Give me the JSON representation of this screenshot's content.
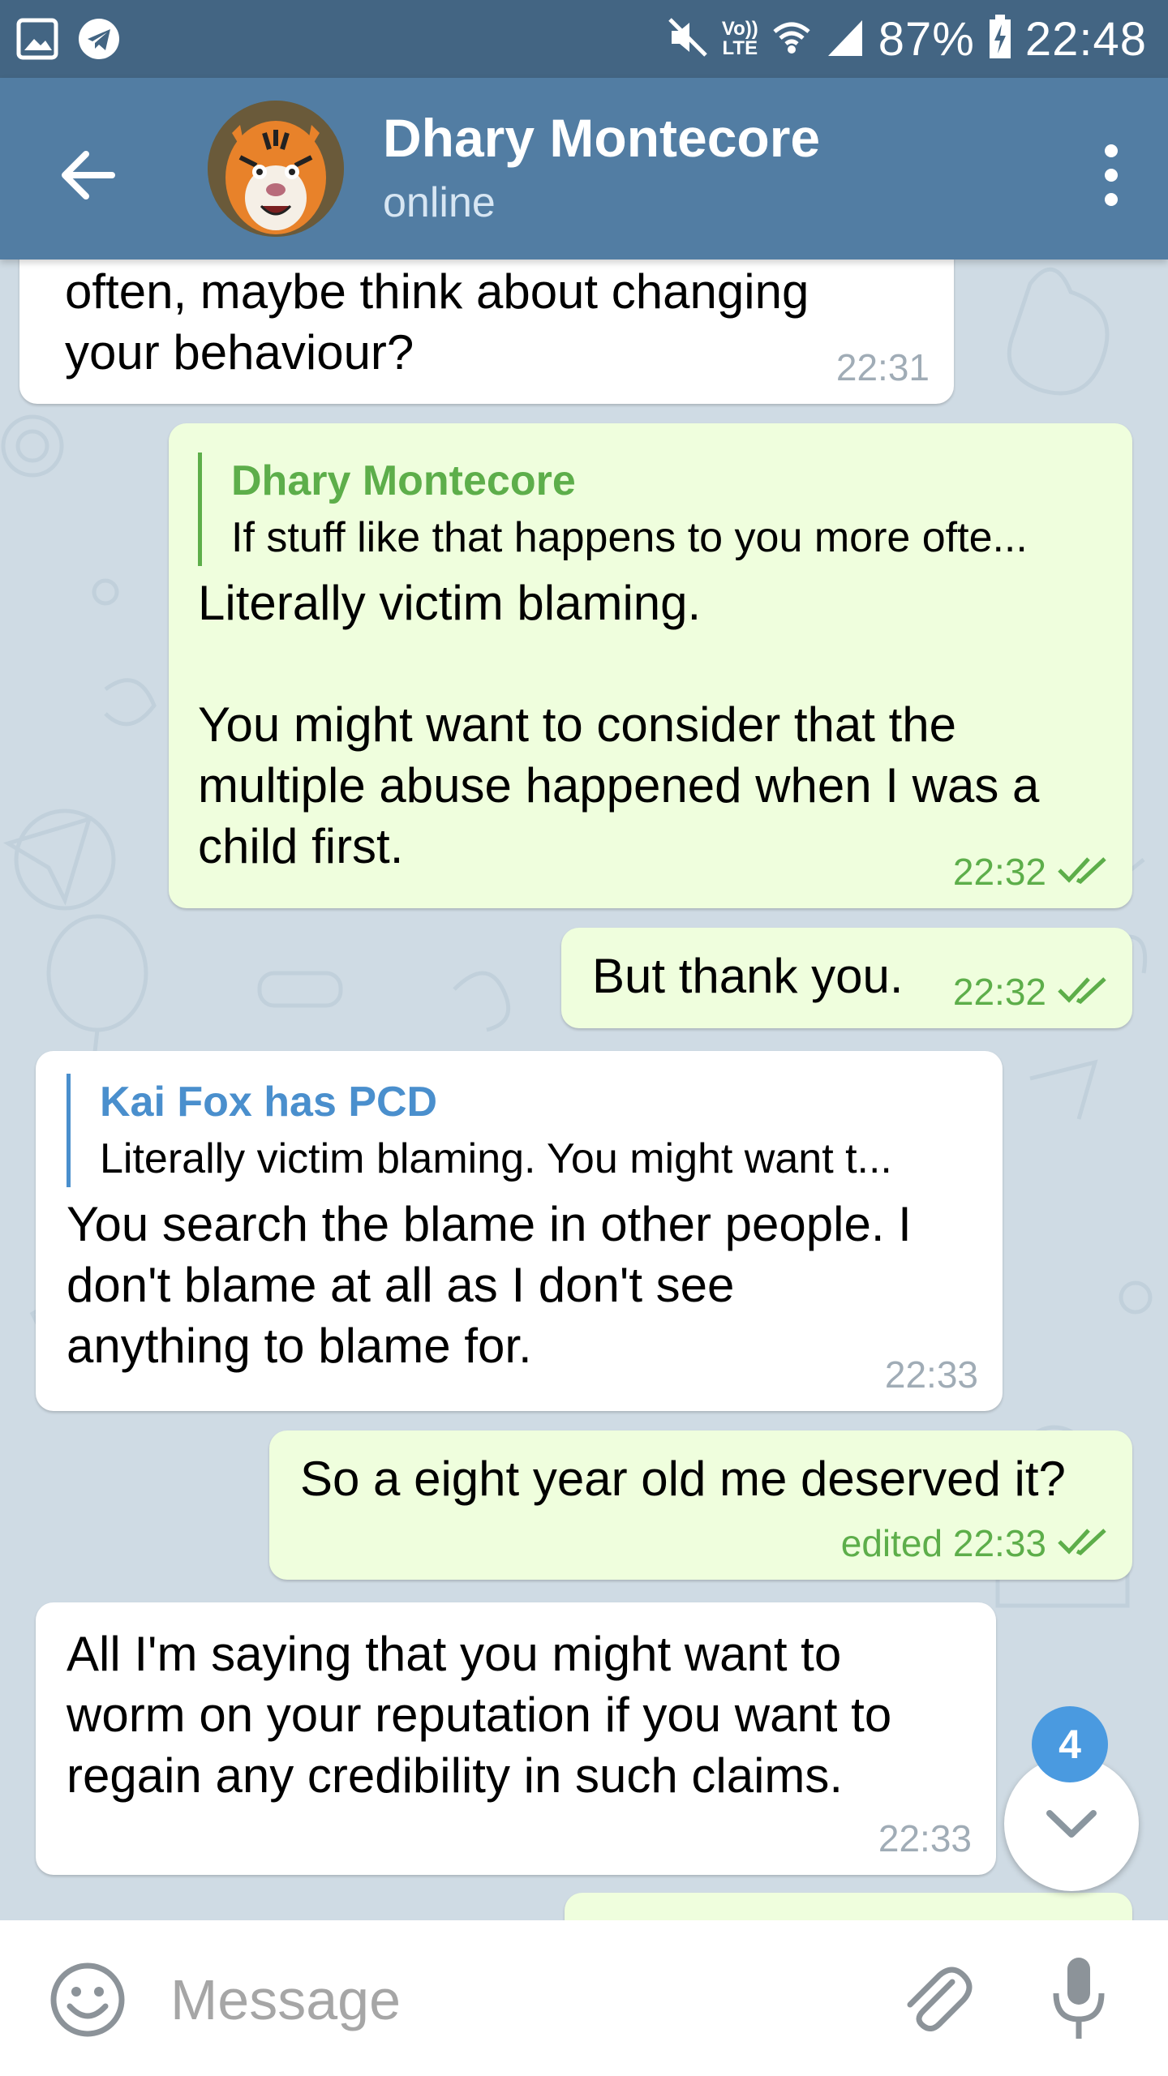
{
  "status_bar": {
    "battery": "87%",
    "time": "22:48",
    "network_top": "Vo))",
    "network_bottom": "LTE"
  },
  "header": {
    "title": "Dhary Montecore",
    "status": "online"
  },
  "messages": [
    {
      "dir": "in",
      "text": "often, maybe think about changing\nyour behaviour?",
      "time": "22:31"
    },
    {
      "dir": "out",
      "reply": {
        "name": "Dhary Montecore",
        "text": "If stuff like that happens to you more ofte..."
      },
      "text": "Literally victim blaming.\n\nYou might want to consider that the\nmultiple abuse happened when I was a\nchild first.",
      "time": "22:32"
    },
    {
      "dir": "out",
      "text": "But thank you.",
      "time": "22:32"
    },
    {
      "dir": "in",
      "reply": {
        "name": "Kai Fox has PCD",
        "text": "Literally victim blaming.  You might want t..."
      },
      "text": "You search the blame in other people. I\ndon't blame at all as I don't see\nanything to blame for.",
      "time": "22:33"
    },
    {
      "dir": "out",
      "text": "So a eight year old me deserved it?",
      "time": "edited 22:33"
    },
    {
      "dir": "in",
      "text": "All I'm saying that you might want to\nworm on your reputation if you want to\nregain any credibility in such claims.",
      "time": "22:33"
    }
  ],
  "scroll_down": {
    "unread_count": "4"
  },
  "input": {
    "placeholder": "Message"
  },
  "colors": {
    "status_bar": "#436583",
    "header": "#527da3",
    "incoming_bubble": "#ffffff",
    "outgoing_bubble": "#effedd",
    "read_check": "#5dae4a",
    "reply_out_accent": "#5dae4a",
    "reply_in_accent": "#4a8fcd",
    "badge": "#4a9ae0"
  }
}
